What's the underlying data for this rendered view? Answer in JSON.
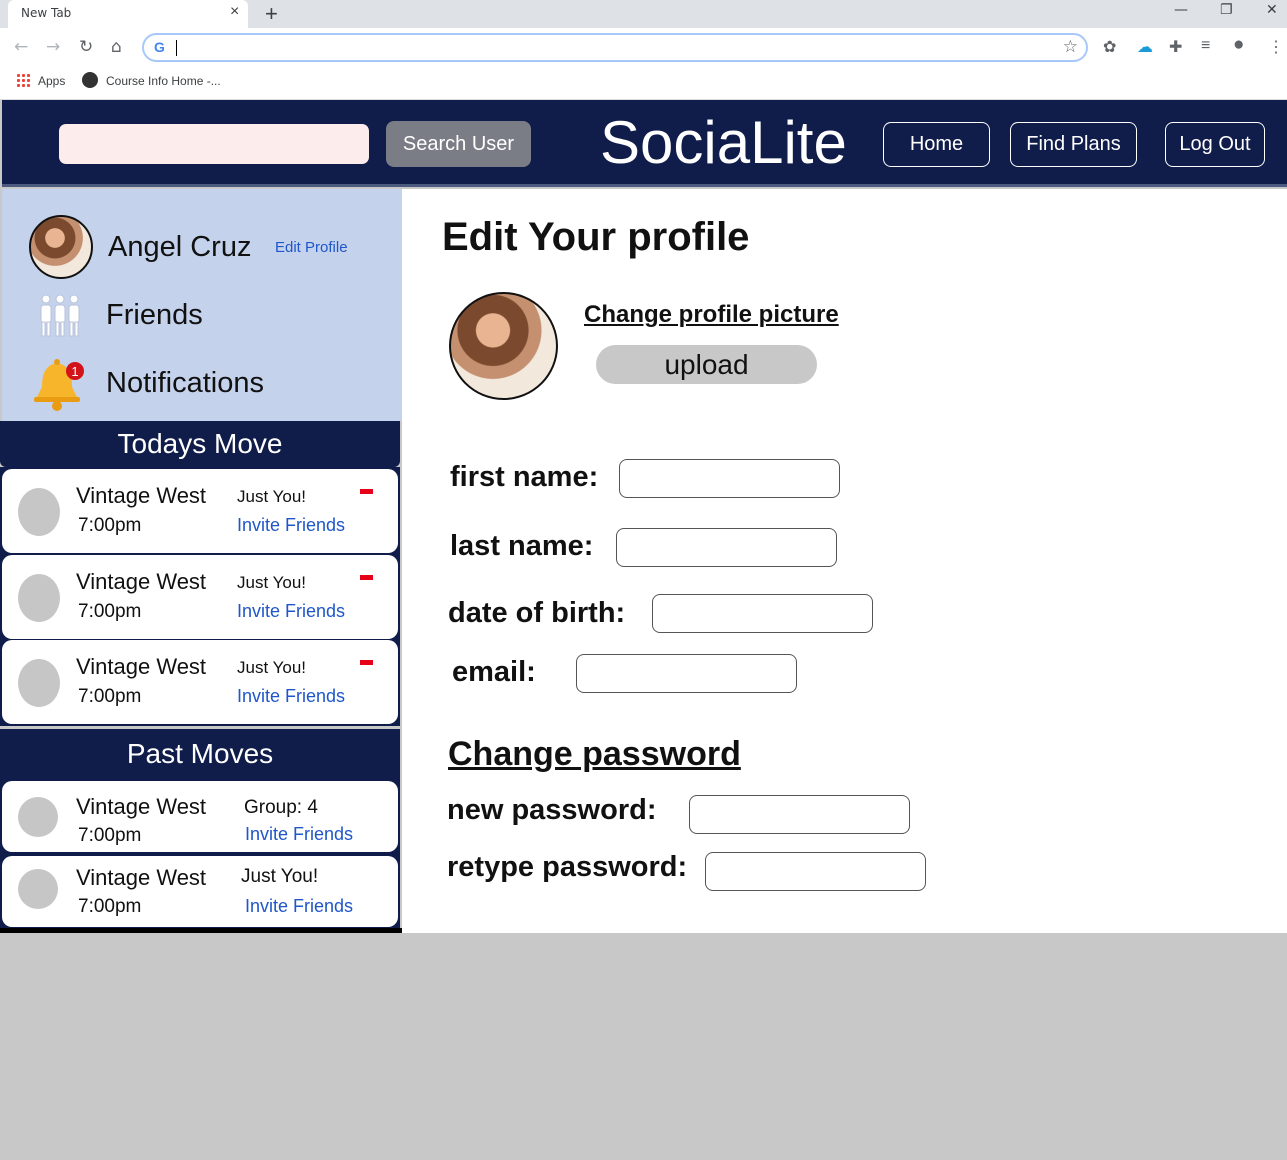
{
  "browser": {
    "tab_title": "New Tab",
    "tab_close": "×",
    "new_tab": "+",
    "window_controls": [
      "—",
      "❐",
      "✕"
    ],
    "nav": [
      "←",
      "→",
      "↻",
      "⌂"
    ],
    "omnibox_value": "",
    "bookmarks": [
      "Apps",
      "Course Info Home -..."
    ]
  },
  "header": {
    "search_placeholder": "",
    "search_button": "Search User",
    "brand": "SociaLite",
    "nav": [
      "Home",
      "Find Plans",
      "Log Out"
    ]
  },
  "sidebar": {
    "user_name": "Angel Cruz",
    "edit_profile": "Edit Profile",
    "friends": "Friends",
    "notifications": "Notifications",
    "notification_count": "1",
    "todays_title": "Todays Move",
    "todays_moves": [
      {
        "place": "Vintage West",
        "time": "7:00pm",
        "who": "Just You!",
        "invite": "Invite Friends"
      },
      {
        "place": "Vintage West",
        "time": "7:00pm",
        "who": "Just You!",
        "invite": "Invite Friends"
      },
      {
        "place": "Vintage West",
        "time": "7:00pm",
        "who": "Just You!",
        "invite": "Invite Friends"
      }
    ],
    "past_title": "Past Moves",
    "past_moves": [
      {
        "place": "Vintage West",
        "time": "7:00pm",
        "who": "Group: 4",
        "invite": "Invite Friends"
      },
      {
        "place": "Vintage West",
        "time": "7:00pm",
        "who": "Just You!",
        "invite": "Invite Friends"
      }
    ]
  },
  "main": {
    "title": "Edit Your profile",
    "change_picture": "Change profile picture",
    "upload": "upload",
    "fields": {
      "first_name": "first name:",
      "last_name": "last name:",
      "dob": "date of birth:",
      "email": "email:"
    },
    "change_password": "Change password",
    "password_fields": {
      "new": "new password:",
      "retype": "retype password:"
    }
  },
  "colors": {
    "header_bg": "#101c4a",
    "sidebar_bg": "#c5d2ec",
    "link": "#1f56c9",
    "remove": "#e6001a"
  }
}
